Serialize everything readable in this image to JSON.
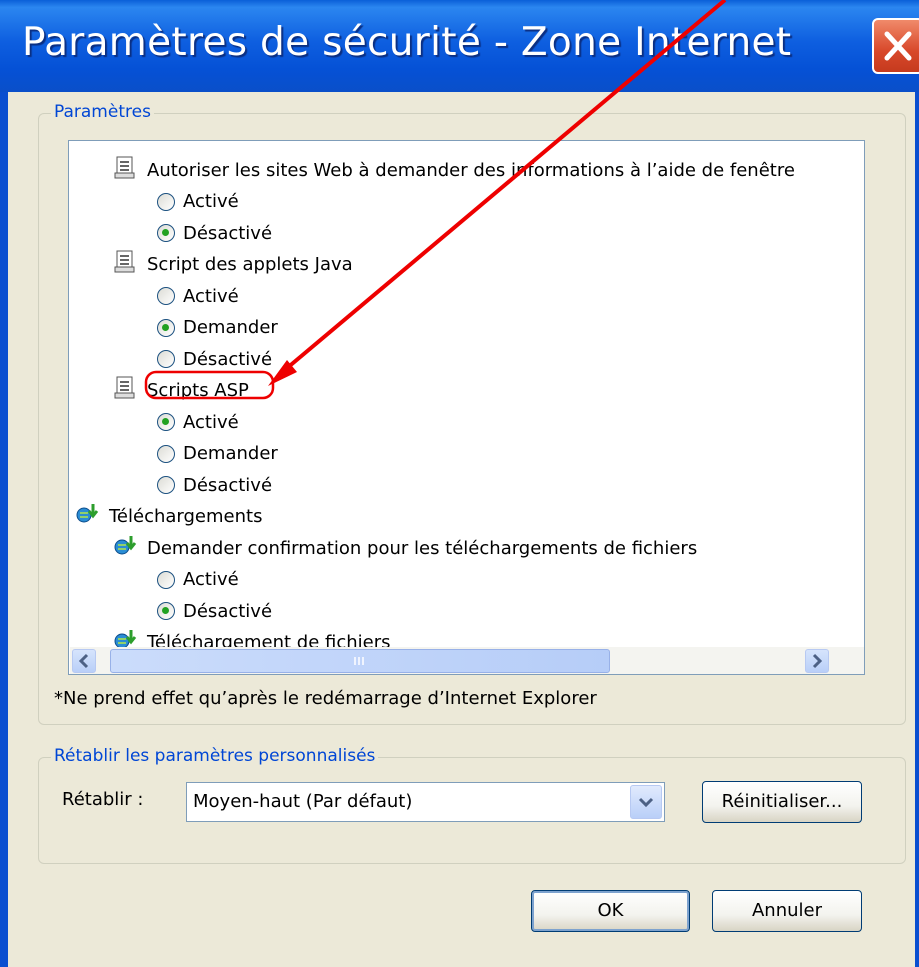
{
  "window": {
    "title": "Paramètres de sécurité - Zone Internet",
    "close_icon": "close-x-icon"
  },
  "settings_group": {
    "legend": "Paramètres",
    "rows": [
      {
        "kind": "setting",
        "icon": "script-icon",
        "label": "Autoriser les sites Web à demander des informations à l’aide de fenêtre"
      },
      {
        "kind": "option",
        "checked": false,
        "label": "Activé"
      },
      {
        "kind": "option",
        "checked": true,
        "label": "Désactivé"
      },
      {
        "kind": "setting",
        "icon": "script-icon",
        "label": "Script des applets Java"
      },
      {
        "kind": "option",
        "checked": false,
        "label": "Activé"
      },
      {
        "kind": "option",
        "checked": true,
        "label": "Demander"
      },
      {
        "kind": "option",
        "checked": false,
        "label": "Désactivé"
      },
      {
        "kind": "setting",
        "icon": "script-icon",
        "label": "Scripts ASP",
        "highlighted": true
      },
      {
        "kind": "option",
        "checked": true,
        "label": "Activé"
      },
      {
        "kind": "option",
        "checked": false,
        "label": "Demander"
      },
      {
        "kind": "option",
        "checked": false,
        "label": "Désactivé"
      },
      {
        "kind": "category",
        "icon": "download-icon",
        "label": "Téléchargements"
      },
      {
        "kind": "setting",
        "icon": "download-icon",
        "label": "Demander confirmation pour les téléchargements de fichiers"
      },
      {
        "kind": "option",
        "checked": false,
        "label": "Activé"
      },
      {
        "kind": "option",
        "checked": true,
        "label": "Désactivé"
      },
      {
        "kind": "setting",
        "icon": "download-icon",
        "label": "Téléchargement de fichiers",
        "partially_visible": true
      }
    ],
    "footnote": "*Ne prend effet qu’après le redémarrage d’Internet Explorer"
  },
  "reset_group": {
    "legend": "Rétablir les paramètres personnalisés",
    "label": "Rétablir :",
    "selected": "Moyen-haut (Par défaut)",
    "reset_button": "Réinitialiser..."
  },
  "buttons": {
    "ok": "OK",
    "cancel": "Annuler"
  },
  "annotation": {
    "color": "#ee0000",
    "target": "Scripts ASP"
  }
}
